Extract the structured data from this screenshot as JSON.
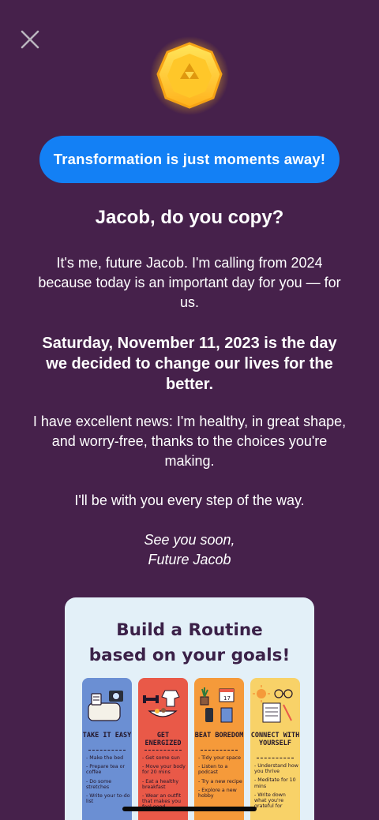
{
  "header": {
    "close_icon": "close-icon",
    "coin_icon": "gold-coin-triforce-icon"
  },
  "banner": {
    "text": "Transformation is just moments away!"
  },
  "letter": {
    "title": "Jacob, do you copy?",
    "paragraph1": "It's me, future Jacob. I'm calling from 2024 because today is an important day for you — for us.",
    "paragraph2": "Saturday, November 11, 2023 is the day we decided to change our lives for the better.",
    "paragraph3": "I have excellent news: I'm healthy, in great shape, and worry-free, thanks to the choices you're making.",
    "paragraph4": "I'll be with you every step of the way.",
    "sign_line1": "See you soon,",
    "sign_line2": "Future Jacob"
  },
  "routine_card": {
    "title_line1": "Build a Routine",
    "title_line2": "based on your goals!",
    "columns": [
      {
        "heading": "TAKE IT EASY",
        "items": [
          "- Make the bed",
          "- Prepare tea or coffee",
          "- Do some stretches",
          "- Write your to-do list"
        ]
      },
      {
        "heading": "GET ENERGIZED",
        "items": [
          "- Get some sun",
          "- Move your body for 20 mins",
          "- Eat a healthy breakfast",
          "- Wear an outfit that makes you feel good"
        ]
      },
      {
        "heading": "BEAT BOREDOM",
        "items": [
          "- Tidy your space",
          "- Listen to a podcast",
          "- Try a new recipe",
          "- Explore a new hobby"
        ]
      },
      {
        "heading": "CONNECT WITH YOURSELF",
        "items": [
          "- Understand how you thrive",
          "- Meditate for 10 mins",
          "- Write down what you're grateful for"
        ]
      }
    ]
  },
  "colors": {
    "background": "#46214b",
    "accent": "#1380f5",
    "card": "#e3f0f8"
  }
}
